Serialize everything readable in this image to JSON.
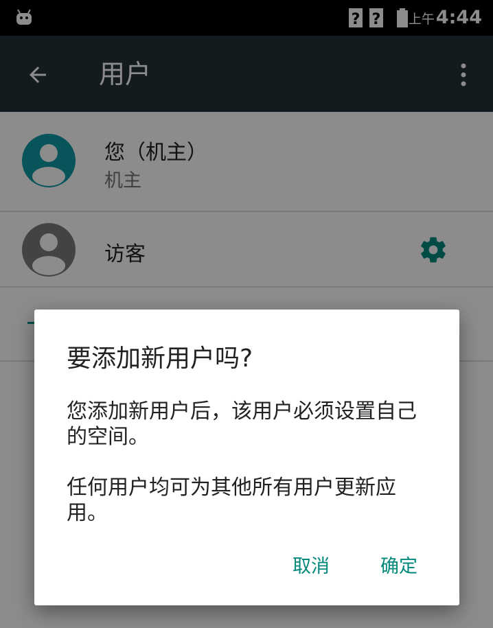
{
  "status_bar": {
    "ampm": "上午",
    "time": "4:44",
    "icons": [
      "android-notification-icon",
      "sim-unknown-icon",
      "sim-unknown-icon",
      "battery-full-icon"
    ]
  },
  "app_bar": {
    "title": "用户",
    "back_icon": "arrow-back-icon",
    "overflow_icon": "more-vert-icon"
  },
  "users": {
    "owner": {
      "name": "您（机主）",
      "subtitle": "机主",
      "avatar_color": "#0e99a6"
    },
    "guest": {
      "name": "访客",
      "avatar_color": "#7b7b7b",
      "settings_icon": "gear-icon"
    }
  },
  "dialog": {
    "title": "要添加新用户吗?",
    "message_1": "您添加新用户后，该用户必须设置自己的空间。",
    "message_2": "任何用户均可为其他所有用户更新应用。",
    "cancel_label": "取消",
    "ok_label": "确定"
  },
  "colors": {
    "app_bar": "#263238",
    "accent": "#00897b",
    "scrim": "rgba(0,0,0,0.45)"
  }
}
